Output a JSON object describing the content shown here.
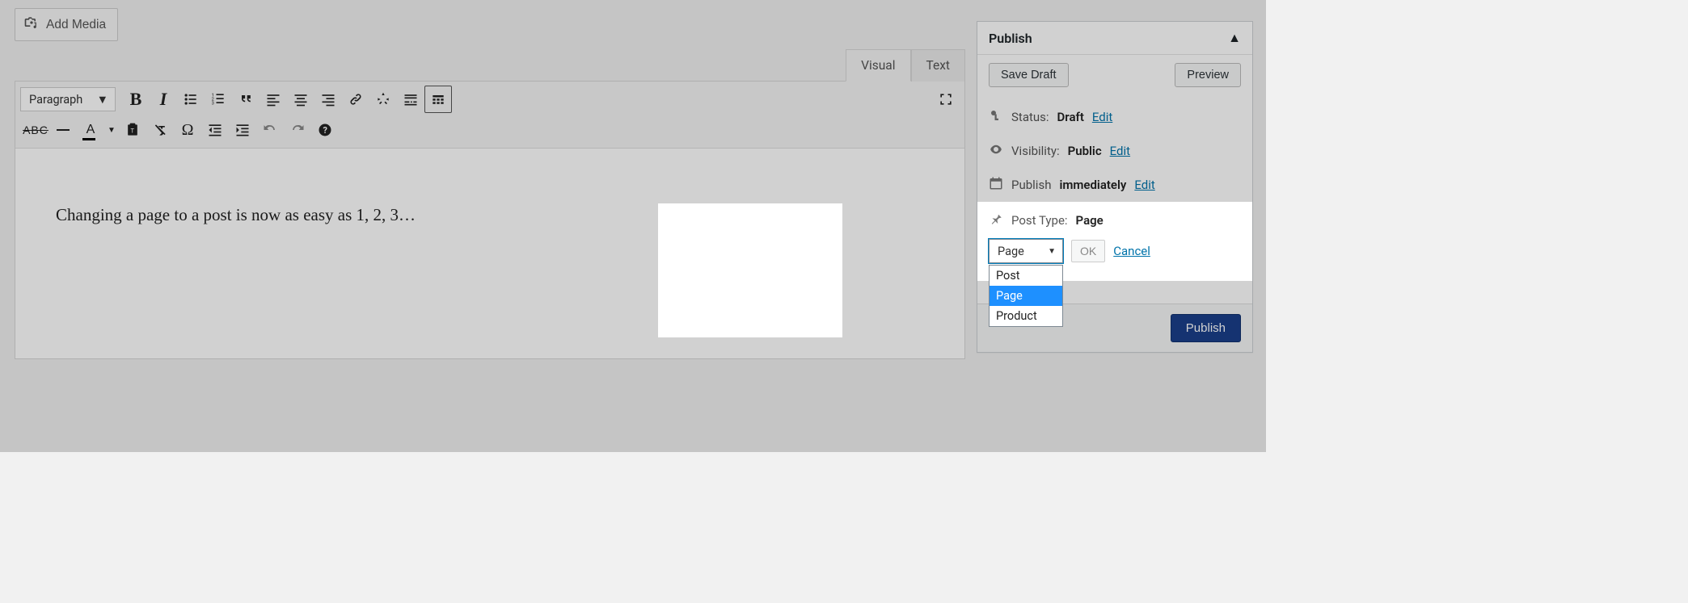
{
  "editor": {
    "add_media_label": "Add Media",
    "tabs": {
      "visual": "Visual",
      "text": "Text"
    },
    "format_select": "Paragraph",
    "content": "Changing a page to a post is now as easy as 1, 2, 3…"
  },
  "publish": {
    "title": "Publish",
    "save_draft": "Save Draft",
    "preview": "Preview",
    "status_label": "Status:",
    "status_value": "Draft",
    "visibility_label": "Visibility:",
    "visibility_value": "Public",
    "schedule_label": "Publish",
    "schedule_value": "immediately",
    "edit": "Edit",
    "posttype_label": "Post Type:",
    "posttype_value": "Page",
    "posttype_selected": "Page",
    "posttype_options": [
      "Post",
      "Page",
      "Product"
    ],
    "ok": "OK",
    "cancel": "Cancel",
    "publish_btn": "Publish"
  }
}
